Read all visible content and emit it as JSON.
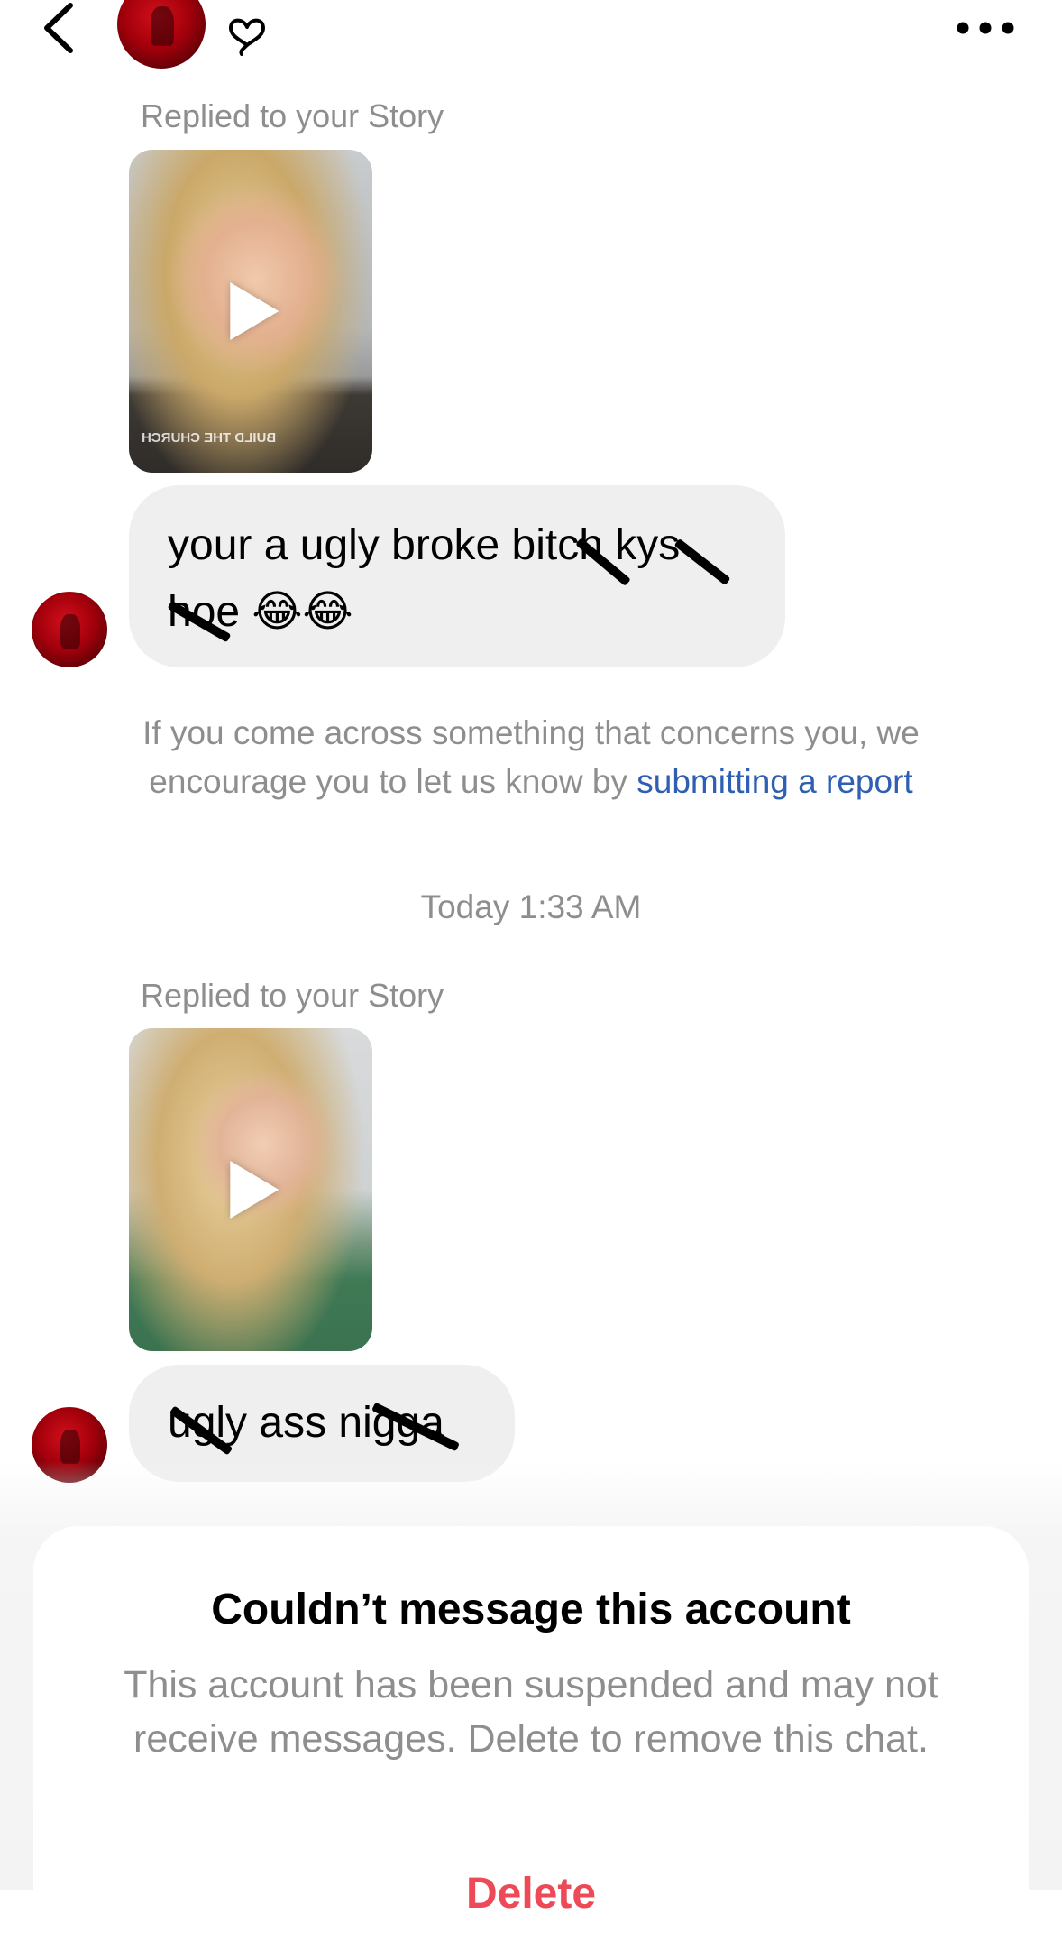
{
  "header": {
    "back_icon": "chevron-left-icon",
    "heart_icon": "heart-outline-icon",
    "more_icon": "more-horizontal-icon"
  },
  "messages": [
    {
      "story_label": "Replied to your Story",
      "story_shirt_text": "BUILD THE CHURCH",
      "text_line1": "your a ugly broke bitch kys",
      "text_line2": "hoe 😂😂"
    },
    {
      "story_label": "Replied to your Story",
      "text": "ugly ass nigga"
    }
  ],
  "safety_note": {
    "text_before": "If you come across something that concerns you, we encourage you to let us know by ",
    "link_text": "submitting a report"
  },
  "timestamp": "Today 1:33 AM",
  "sheet": {
    "title": "Couldn’t message this account",
    "description": "This account has been suspended and may not receive messages. Delete to remove this chat.",
    "action_label": "Delete"
  },
  "colors": {
    "secondary_text": "#8e8e8e",
    "link": "#2f5fb3",
    "bubble": "#efefef",
    "destructive": "#ed4956"
  }
}
